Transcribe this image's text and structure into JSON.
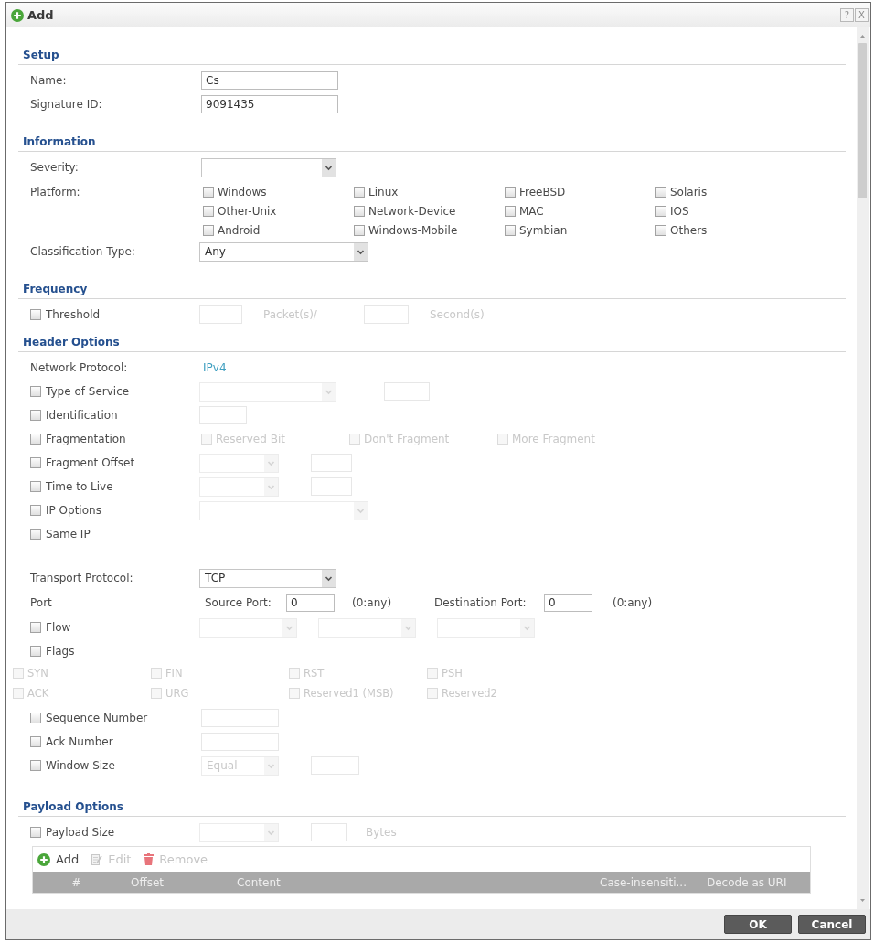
{
  "window": {
    "title": "Add",
    "title_buttons": [
      "?",
      "X"
    ]
  },
  "sections": [
    {
      "title": "Setup",
      "rows": [
        {
          "kind": "field",
          "label": "Name:",
          "controls": [
            {
              "kind": "input",
              "value": "Cs",
              "disabled": false
            }
          ]
        },
        {
          "kind": "field",
          "label": "Signature ID:",
          "controls": [
            {
              "kind": "input",
              "value": "9091435",
              "disabled": false
            }
          ]
        }
      ]
    },
    {
      "title": "Information",
      "rows": [
        {
          "kind": "field",
          "label": "Severity:",
          "controls": [
            {
              "kind": "select",
              "disabled": false
            }
          ]
        },
        {
          "kind": "field",
          "label": "Platform:",
          "controls": [
            {
              "kind": "checks",
              "items": [
                {
                  "label": "Windows",
                  "checked": false,
                  "disabled": false
                },
                {
                  "label": "Linux",
                  "checked": false,
                  "disabled": false
                },
                {
                  "label": "FreeBSD",
                  "checked": false,
                  "disabled": false
                },
                {
                  "label": "Solaris",
                  "checked": false,
                  "disabled": false
                },
                {
                  "label": "Other-Unix",
                  "checked": false,
                  "disabled": false
                },
                {
                  "label": "Network-Device",
                  "checked": false,
                  "disabled": false
                },
                {
                  "label": "MAC",
                  "checked": false,
                  "disabled": false
                },
                {
                  "label": "IOS",
                  "checked": false,
                  "disabled": false
                },
                {
                  "label": "Android",
                  "checked": false,
                  "disabled": false
                },
                {
                  "label": "Windows-Mobile",
                  "checked": false,
                  "disabled": false
                },
                {
                  "label": "Symbian",
                  "checked": false,
                  "disabled": false
                },
                {
                  "label": "Others",
                  "checked": false,
                  "disabled": false
                }
              ]
            }
          ]
        },
        {
          "kind": "field",
          "label": "Classification Type:",
          "controls": [
            {
              "kind": "select",
              "value": "Any",
              "disabled": false
            }
          ]
        }
      ]
    },
    {
      "title": "Frequency",
      "rows": [
        {
          "kind": "check",
          "label": "Threshold",
          "checked": false,
          "controls": [
            {
              "kind": "input",
              "disabled": true
            },
            {
              "kind": "text",
              "text": "Packet(s)/",
              "disabled": true
            },
            {
              "kind": "input",
              "disabled": true
            },
            {
              "kind": "text",
              "text": "Second(s)",
              "disabled": true
            }
          ]
        }
      ]
    },
    {
      "title": "Header Options",
      "rows": [
        {
          "kind": "field",
          "label": "Network Protocol:",
          "controls": [
            {
              "kind": "value",
              "text": "IPv4"
            }
          ]
        },
        {
          "kind": "check",
          "label": "Type of Service",
          "checked": false,
          "controls": [
            {
              "kind": "select",
              "disabled": true
            },
            {
              "kind": "input",
              "disabled": true
            }
          ]
        },
        {
          "kind": "check",
          "label": "Identification",
          "checked": false,
          "controls": [
            {
              "kind": "input",
              "disabled": true
            }
          ]
        },
        {
          "kind": "check",
          "label": "Fragmentation",
          "checked": false,
          "controls": [
            {
              "kind": "checks",
              "items": [
                {
                  "label": "Reserved Bit",
                  "checked": false,
                  "disabled": true
                },
                {
                  "label": "Don't Fragment",
                  "checked": false,
                  "disabled": true
                },
                {
                  "label": "More Fragment",
                  "checked": false,
                  "disabled": true
                }
              ]
            }
          ]
        },
        {
          "kind": "check",
          "label": "Fragment Offset",
          "checked": false,
          "controls": [
            {
              "kind": "select",
              "disabled": true
            },
            {
              "kind": "input",
              "disabled": true
            }
          ]
        },
        {
          "kind": "check",
          "label": "Time to Live",
          "checked": false,
          "controls": [
            {
              "kind": "select",
              "disabled": true
            },
            {
              "kind": "input",
              "disabled": true
            }
          ]
        },
        {
          "kind": "check",
          "label": "IP Options",
          "checked": false,
          "controls": [
            {
              "kind": "select",
              "disabled": true
            }
          ]
        },
        {
          "kind": "check",
          "label": "Same IP",
          "checked": false
        },
        {
          "kind": "field",
          "label": "Transport Protocol:",
          "controls": [
            {
              "kind": "select",
              "value": "TCP",
              "disabled": false
            }
          ]
        },
        {
          "kind": "field",
          "label": "Port",
          "controls": [
            {
              "kind": "text",
              "text": "Source Port:",
              "disabled": false
            },
            {
              "kind": "input",
              "value": "0",
              "disabled": false
            },
            {
              "kind": "text",
              "text": "(0:any)",
              "disabled": false
            },
            {
              "kind": "text",
              "text": "Destination Port:",
              "disabled": false
            },
            {
              "kind": "input",
              "value": "0",
              "disabled": false
            },
            {
              "kind": "text",
              "text": "(0:any)",
              "disabled": false
            }
          ]
        },
        {
          "kind": "check",
          "label": "Flow",
          "checked": false,
          "controls": [
            {
              "kind": "select",
              "disabled": true
            },
            {
              "kind": "select",
              "disabled": true
            },
            {
              "kind": "select",
              "disabled": true
            }
          ]
        },
        {
          "kind": "check",
          "label": "Flags",
          "checked": false
        },
        {
          "kind": "flags",
          "items": [
            {
              "label": "SYN",
              "checked": false,
              "disabled": true
            },
            {
              "label": "FIN",
              "checked": false,
              "disabled": true
            },
            {
              "label": "RST",
              "checked": false,
              "disabled": true
            },
            {
              "label": "PSH",
              "checked": false,
              "disabled": true
            },
            {
              "label": "ACK",
              "checked": false,
              "disabled": true
            },
            {
              "label": "URG",
              "checked": false,
              "disabled": true
            },
            {
              "label": "Reserved1 (MSB)",
              "checked": false,
              "disabled": true
            },
            {
              "label": "Reserved2",
              "checked": false,
              "disabled": true
            }
          ]
        },
        {
          "kind": "check",
          "label": "Sequence Number",
          "checked": false,
          "controls": [
            {
              "kind": "input",
              "disabled": true
            }
          ]
        },
        {
          "kind": "check",
          "label": "Ack Number",
          "checked": false,
          "controls": [
            {
              "kind": "input",
              "disabled": true
            }
          ]
        },
        {
          "kind": "check",
          "label": "Window Size",
          "checked": false,
          "controls": [
            {
              "kind": "select",
              "value": "Equal",
              "disabled": true
            },
            {
              "kind": "input",
              "disabled": true
            }
          ]
        }
      ]
    },
    {
      "title": "Payload Options",
      "rows": [
        {
          "kind": "check",
          "label": "Payload Size",
          "checked": false,
          "controls": [
            {
              "kind": "select",
              "disabled": true
            },
            {
              "kind": "input",
              "disabled": true
            },
            {
              "kind": "text",
              "text": "Bytes",
              "disabled": true
            }
          ]
        },
        {
          "kind": "table",
          "toolbar": [
            {
              "kind": "add",
              "label": "Add",
              "disabled": false
            },
            {
              "kind": "edit",
              "label": "Edit",
              "disabled": true
            },
            {
              "kind": "remove",
              "label": "Remove",
              "disabled": true
            }
          ],
          "columns": [
            "#",
            "Offset",
            "Content",
            "Case-insensiti...",
            "Decode as URI"
          ]
        }
      ]
    }
  ],
  "buttons": [
    "OK",
    "Cancel"
  ]
}
